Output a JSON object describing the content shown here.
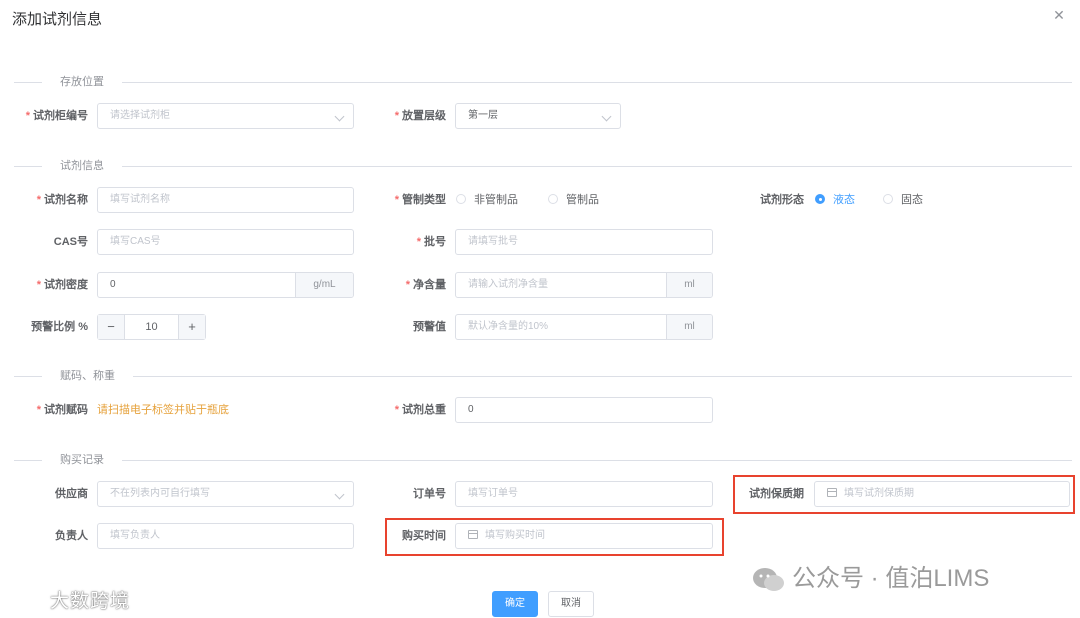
{
  "dialog": {
    "title": "添加试剂信息",
    "close_icon": "close-icon"
  },
  "sections": {
    "storage": "存放位置",
    "reagent": "试剂信息",
    "code_weight": "赋码、称重",
    "purchase": "购买记录"
  },
  "storage": {
    "cabinet_label": "试剂柜编号",
    "cabinet_placeholder": "请选择试剂柜",
    "level_label": "放置层级",
    "level_value": "第一层"
  },
  "reagent": {
    "name_label": "试剂名称",
    "name_placeholder": "填写试剂名称",
    "control_type_label": "管制类型",
    "control_options": [
      {
        "label": "非管制品",
        "checked": false
      },
      {
        "label": "管制品",
        "checked": false
      }
    ],
    "form_label": "试剂形态",
    "form_options": [
      {
        "label": "液态",
        "checked": true
      },
      {
        "label": "固态",
        "checked": false
      }
    ],
    "cas_label": "CAS号",
    "cas_placeholder": "填写CAS号",
    "batch_label": "批号",
    "batch_placeholder": "请填写批号",
    "density_label": "试剂密度",
    "density_value": "0",
    "density_unit": "g/mL",
    "net_label": "净含量",
    "net_placeholder": "请输入试剂净含量",
    "net_unit": "ml",
    "warn_ratio_label": "预警比例 %",
    "warn_ratio_value": "10",
    "warn_value_label": "预警值",
    "warn_value_placeholder": "默认净含量的10%",
    "warn_value_unit": "ml"
  },
  "code_weight": {
    "code_label": "试剂赋码",
    "code_hint": "请扫描电子标签并贴于瓶底",
    "total_label": "试剂总重",
    "total_value": "0"
  },
  "purchase": {
    "supplier_label": "供应商",
    "supplier_placeholder": "不在列表内可自行填写",
    "order_label": "订单号",
    "order_placeholder": "填写订单号",
    "shelf_life_label": "试剂保质期",
    "shelf_life_placeholder": "填写试剂保质期",
    "owner_label": "负责人",
    "owner_placeholder": "填写负责人",
    "buy_time_label": "购买时间",
    "buy_time_placeholder": "填写购买时间"
  },
  "buttons": {
    "confirm": "确定",
    "cancel": "取消"
  },
  "watermarks": {
    "left": "大数跨境",
    "right": "公众号 · 值泊LIMS"
  },
  "colors": {
    "primary": "#409eff",
    "required": "#f56c6c",
    "hint": "#e6a23c",
    "highlight": "#e8432e"
  }
}
